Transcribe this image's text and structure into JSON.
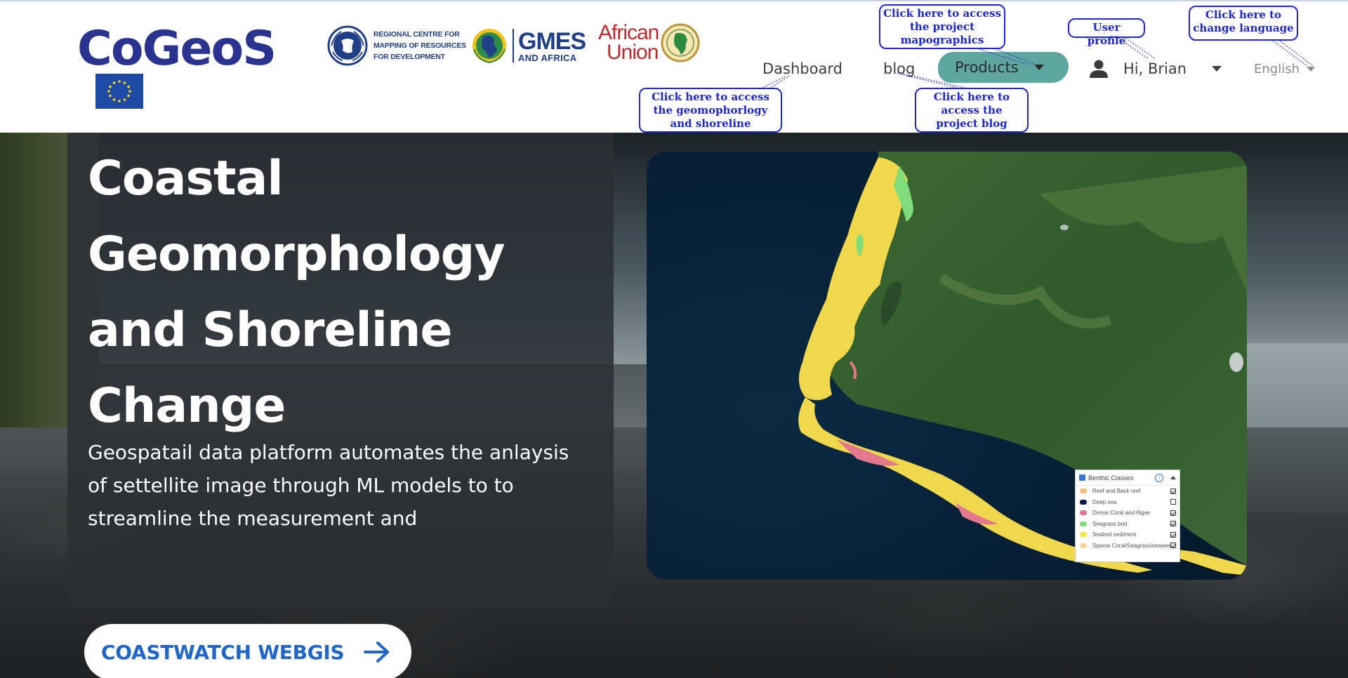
{
  "header": {
    "brand": "CoGeoS",
    "partners": {
      "rcmrd_lines": [
        "REGIONAL CENTRE FOR",
        "MAPPING OF RESOURCES",
        "FOR DEVELOPMENT"
      ],
      "gmes_line1": "GMES",
      "gmes_line2": "AND AFRICA",
      "au_line1": "African",
      "au_line2": "Union"
    },
    "nav": {
      "dashboard": "Dashboard",
      "blog": "blog",
      "products": "Products",
      "user_greeting": "Hi, Brian",
      "language": "English"
    },
    "callouts": {
      "mapographics": "Click here to access the project mapographics",
      "user_profile": "User profile",
      "language": "Click here to change language",
      "geomorphology": "Click here to access the geomophorlogy and shoreline products",
      "blog": "Click here to access the project blog posts"
    }
  },
  "hero": {
    "title": "Coastal Geomorphology and Shoreline Change",
    "description": "Geospatail data platform automates the anlaysis of settellite image through ML models to to streamline the measurement and",
    "cta_label": "COASTWATCH WEBGIS"
  },
  "map_legend": {
    "title": "Benthic Classes",
    "items": [
      {
        "label": "Reef and Back reef",
        "color": "#f6c07a",
        "checked": true
      },
      {
        "label": "Deep sea",
        "color": "#0b1c4a",
        "checked": false
      },
      {
        "label": "Dense Coral and Algae",
        "color": "#e4788c",
        "checked": true
      },
      {
        "label": "Seagrass bed",
        "color": "#7fdc7a",
        "checked": true
      },
      {
        "label": "Seabed sediment",
        "color": "#ecec4a",
        "checked": true
      },
      {
        "label": "Sparse Coral/Seagrass/seaweed",
        "color": "#f7d39c",
        "checked": true
      }
    ]
  },
  "colors": {
    "brand": "#2b3390",
    "products_highlight": "#5ea6a0",
    "callout": "#1c25d8",
    "cta_text": "#1f66c8"
  }
}
